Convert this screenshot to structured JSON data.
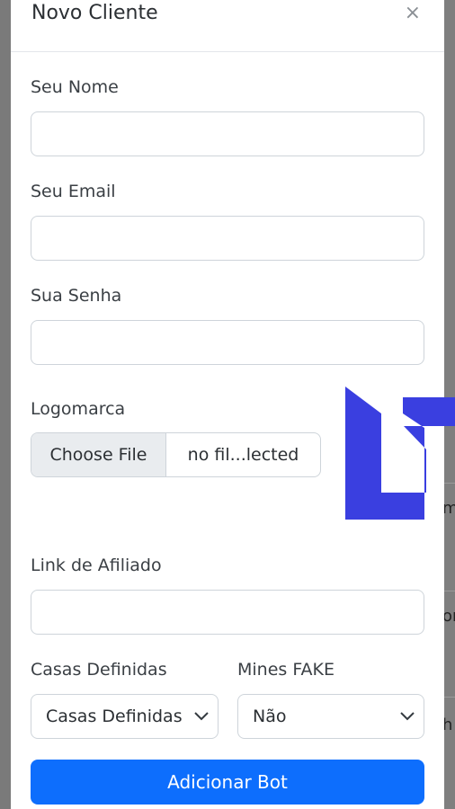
{
  "modal": {
    "title": "Novo Cliente",
    "close_label": "×"
  },
  "form": {
    "name_label": "Seu Nome",
    "name_value": "",
    "email_label": "Seu Email",
    "email_value": "",
    "password_label": "Sua Senha",
    "password_value": "",
    "logo_label": "Logomarca",
    "logo_button": "Choose File",
    "logo_filename": "no fil...lected",
    "affiliate_label": "Link de Afiliado",
    "affiliate_value": "",
    "houses_label": "Casas Definidas",
    "houses_selected": "Casas Definidas",
    "mines_label": "Mines FAKE",
    "mines_selected": "Não",
    "submit_label": "Adicionar Bot"
  },
  "backdrop": {
    "fragment_1": "m",
    "fragment_2": "or",
    "fragment_3": "h"
  },
  "colors": {
    "primary": "#0d6efd",
    "watermark": "#3a3fe0"
  }
}
